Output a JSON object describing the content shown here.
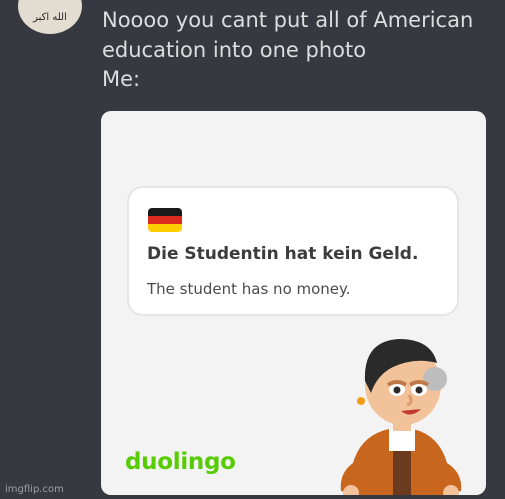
{
  "message": {
    "lines": [
      "Noooo you cant put all of American",
      "education into one photo",
      "Me:"
    ]
  },
  "avatar": {
    "text": "الله اکبر"
  },
  "card": {
    "sentence": "Die Studentin hat kein Geld.",
    "translation": "The student has no money.",
    "logo": "duolingo",
    "flag": {
      "stripes": [
        "#1a1a1a",
        "#dd2c1f",
        "#ffce00"
      ]
    }
  },
  "watermark": "imgflip.com",
  "colors": {
    "background": "#36393f",
    "text": "#dcddde",
    "brand_green": "#58cc02"
  }
}
